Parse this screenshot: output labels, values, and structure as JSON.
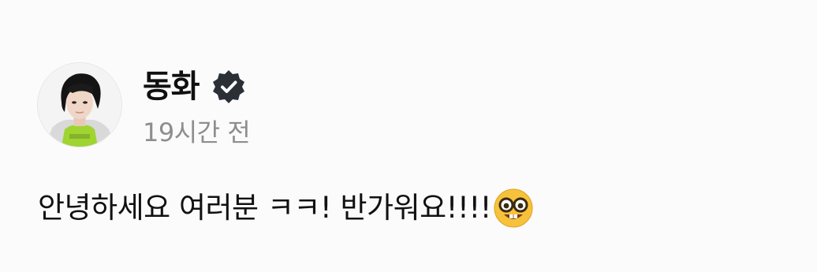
{
  "post": {
    "author": {
      "name": "동화",
      "verified": true,
      "avatar_icon": "profile-photo"
    },
    "timestamp": "19시간 전",
    "message": "안녕하세요 여러분 ㅋㅋ! 반가워요!!!!",
    "message_emoji": "nerd-face-emoji"
  },
  "colors": {
    "background": "#fbfbfb",
    "text_primary": "#111111",
    "text_secondary": "#8e8e8e",
    "verified_badge": "#2b2f36"
  }
}
